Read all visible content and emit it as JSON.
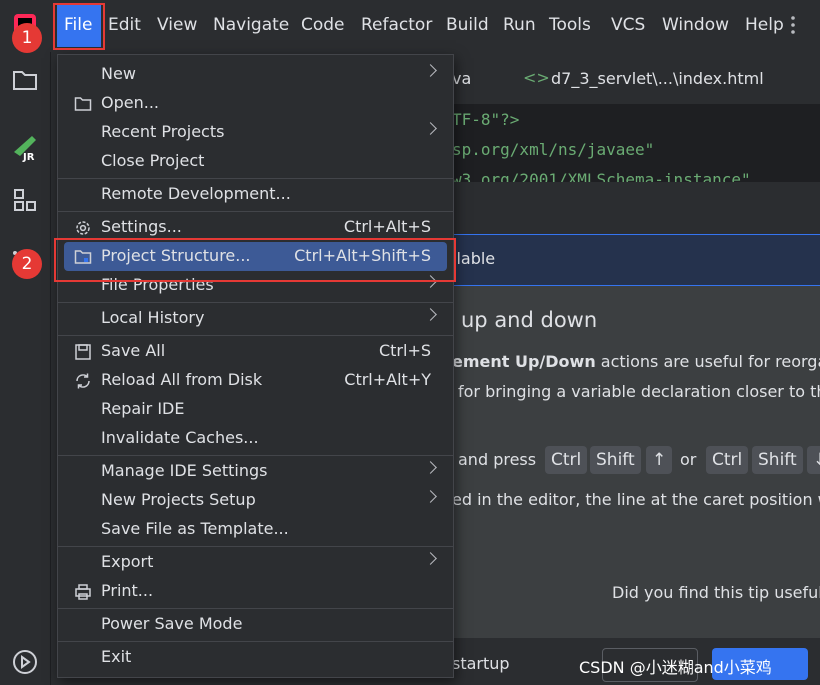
{
  "menubar": {
    "items": [
      "File",
      "Edit",
      "View",
      "Navigate",
      "Code",
      "Refactor",
      "Build",
      "Run",
      "Tools",
      "VCS",
      "Window",
      "Help"
    ]
  },
  "tabs": [
    {
      "label": "va"
    },
    {
      "label": "d7_3_servlet\\...\\index.html"
    }
  ],
  "editor": {
    "lines": [
      "TF-8\"?>",
      "sp.org/xml/ns/javaee\"",
      "w3.org/2001/XMLSchema-instance\""
    ]
  },
  "dialog": {
    "banner": "ilable",
    "heading": "up and down",
    "para1_bold": "ement Up/Down",
    "para1_rest": " actions are useful for reorga",
    "para2": "for bringing a variable declaration closer to th",
    "press_prefix": "and press",
    "keys1": [
      "Ctrl",
      "Shift",
      "↑"
    ],
    "or": "or",
    "keys2": [
      "Ctrl",
      "Shift",
      "↓"
    ],
    "para3": "ed in the editor, the line at the caret position w",
    "feedback": "Did you find this tip useful",
    "startup": "startup",
    "watermark": "CSDN @小迷糊and小菜鸡"
  },
  "menu": {
    "rows": [
      {
        "label": "New",
        "shortcut": "",
        "submenu": true,
        "icon": ""
      },
      {
        "label": "Open...",
        "shortcut": "",
        "submenu": false,
        "icon": "folder-icon"
      },
      {
        "label": "Recent Projects",
        "shortcut": "",
        "submenu": true,
        "icon": ""
      },
      {
        "label": "Close Project",
        "shortcut": "",
        "submenu": false,
        "icon": ""
      },
      {
        "label": "Remote Development...",
        "shortcut": "",
        "submenu": false,
        "icon": ""
      },
      {
        "label": "Settings...",
        "shortcut": "Ctrl+Alt+S",
        "submenu": false,
        "icon": "gear-icon"
      },
      {
        "label": "Project Structure...",
        "shortcut": "Ctrl+Alt+Shift+S",
        "submenu": false,
        "icon": "project-structure-icon",
        "highlighted": true
      },
      {
        "label": "File Properties",
        "shortcut": "",
        "submenu": true,
        "icon": ""
      },
      {
        "label": "Local History",
        "shortcut": "",
        "submenu": true,
        "icon": ""
      },
      {
        "label": "Save All",
        "shortcut": "Ctrl+S",
        "submenu": false,
        "icon": "save-icon"
      },
      {
        "label": "Reload All from Disk",
        "shortcut": "Ctrl+Alt+Y",
        "submenu": false,
        "icon": "reload-icon"
      },
      {
        "label": "Repair IDE",
        "shortcut": "",
        "submenu": false,
        "icon": ""
      },
      {
        "label": "Invalidate Caches...",
        "shortcut": "",
        "submenu": false,
        "icon": ""
      },
      {
        "label": "Manage IDE Settings",
        "shortcut": "",
        "submenu": true,
        "icon": ""
      },
      {
        "label": "New Projects Setup",
        "shortcut": "",
        "submenu": true,
        "icon": ""
      },
      {
        "label": "Save File as Template...",
        "shortcut": "",
        "submenu": false,
        "icon": ""
      },
      {
        "label": "Export",
        "shortcut": "",
        "submenu": true,
        "icon": ""
      },
      {
        "label": "Print...",
        "shortcut": "",
        "submenu": false,
        "icon": "print-icon"
      },
      {
        "label": "Power Save Mode",
        "shortcut": "",
        "submenu": false,
        "icon": ""
      },
      {
        "label": "Exit",
        "shortcut": "",
        "submenu": false,
        "icon": ""
      }
    ]
  },
  "annotations": {
    "badge1": "1",
    "badge2": "2"
  },
  "colors": {
    "accent": "#3574f0",
    "highlight": "#3d5a96",
    "annotation": "#e53935"
  }
}
